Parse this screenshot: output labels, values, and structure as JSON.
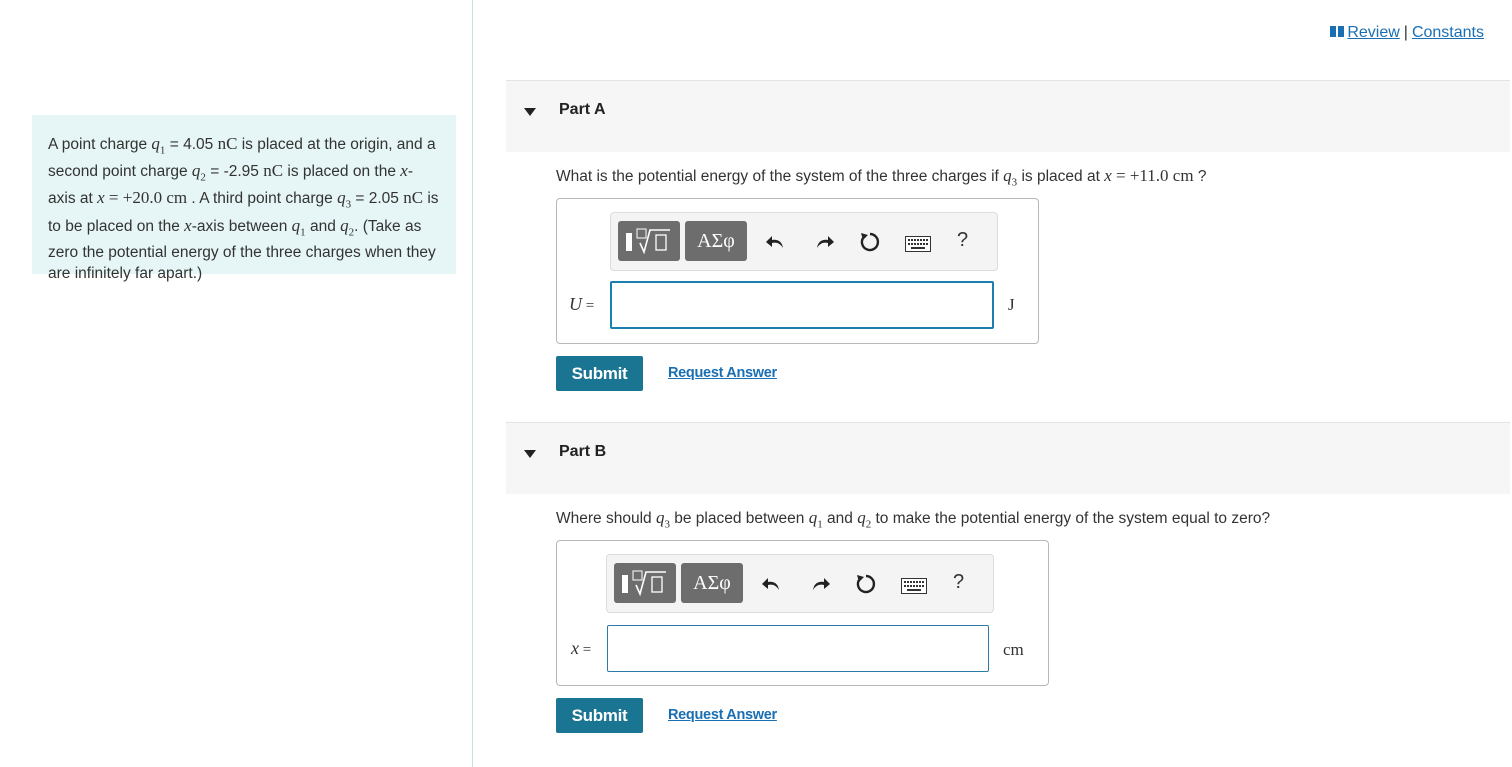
{
  "header": {
    "review_label": "Review",
    "separator": "|",
    "constants_label": "Constants"
  },
  "problem": {
    "t1": "A point charge ",
    "q1_sym": "q",
    "q1_sub": "1",
    "t2": " = 4.05 ",
    "unit_nC": "nC",
    "t3": " is placed at the origin, and a second point charge ",
    "q2_sym": "q",
    "q2_sub": "2",
    "t4": " = -2.95 ",
    "t5": " is placed on the ",
    "x_sym": "x",
    "t6": "-axis at ",
    "x_eq": "x",
    "x_val": " = +20.0 ",
    "unit_cm": "cm",
    "t7": " . A third point charge ",
    "q3_sym": "q",
    "q3_sub": "3",
    "t8": " = 2.05 ",
    "t9": " is to be placed on the ",
    "t10": "-axis between ",
    "t11": " and ",
    "t12": ". (Take as zero the potential energy of the three charges when they are infinitely far apart.)"
  },
  "partA": {
    "label": "Part A",
    "question_pre": "What is the potential energy of the system of the three charges if ",
    "question_mid": " is placed at ",
    "question_val": " = +11.0 ",
    "question_unit": "cm",
    "question_end": " ?",
    "toolbar": {
      "greek": "ΑΣφ",
      "help": "?"
    },
    "var": "U",
    "eq": " =",
    "unit": "J",
    "input_value": "",
    "submit": "Submit",
    "request_answer": "Request Answer"
  },
  "partB": {
    "label": "Part B",
    "question_pre": "Where should ",
    "question_mid": " be placed between ",
    "question_and": " and ",
    "question_end": " to make the potential energy of the system equal to zero?",
    "toolbar": {
      "greek": "ΑΣφ",
      "help": "?"
    },
    "var": "x",
    "eq": " =",
    "unit": "cm",
    "input_value": "",
    "submit": "Submit",
    "request_answer": "Request Answer"
  },
  "colors": {
    "accent": "#1a7593",
    "link": "#1a6fb3",
    "problem_bg": "#e6f5f5",
    "part_bar_bg": "#f6f6f6"
  }
}
